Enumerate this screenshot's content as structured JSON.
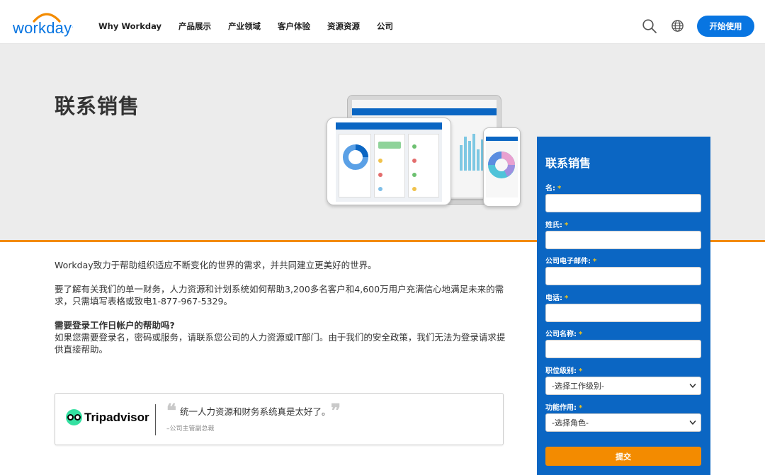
{
  "header": {
    "logo_text": "workday",
    "nav": [
      "Why Workday",
      "产品展示",
      "产业领域",
      "客户体验",
      "资源资源",
      "公司"
    ],
    "cta_label": "开始使用"
  },
  "hero": {
    "title": "联系销售"
  },
  "content": {
    "intro": "Workday致力于帮助组织适应不断变化的世界的需求，并共同建立更美好的世界。",
    "contact_line1": "要了解有关我们的单一财务，人力资源和计划系统如何帮助3,200多名客户和4,600万用户充满信心地满足未来的需",
    "contact_line2": "求，只需填写表格或致电1-877-967-5329。",
    "help_heading": "需要登录工作日帐户的帮助吗?",
    "help_line1": "如果您需要登录名，密码或服务，请联系您公司的人力资源或IT部门。由于我们的安全政策，我们无法为登录请求提",
    "help_line2": "供直接帮助。"
  },
  "testimonial": {
    "brand": "Tripadvisor",
    "quote": "统一人力资源和财务系统真是太好了。",
    "author": "–公司主管副总裁"
  },
  "form": {
    "title": "联系销售",
    "first_name_label": "名:",
    "last_name_label": "姓氏:",
    "email_label": "公司电子邮件:",
    "phone_label": "电话:",
    "company_label": "公司名称:",
    "job_level_label": "职位级别:",
    "job_level_value": "-选择工作级别-",
    "function_label": "功能作用:",
    "function_value": "-选择角色-",
    "required_mark": "*",
    "submit_label": "提交"
  },
  "colors": {
    "brand_blue": "#0875e1",
    "form_blue": "#0b66c3",
    "accent_orange": "#f38b00",
    "hero_gray": "#ececec",
    "tripadvisor_green": "#34e0a1"
  },
  "icons": [
    "search-icon",
    "globe-icon",
    "tripadvisor-owl-icon",
    "chevron-down-icon"
  ]
}
